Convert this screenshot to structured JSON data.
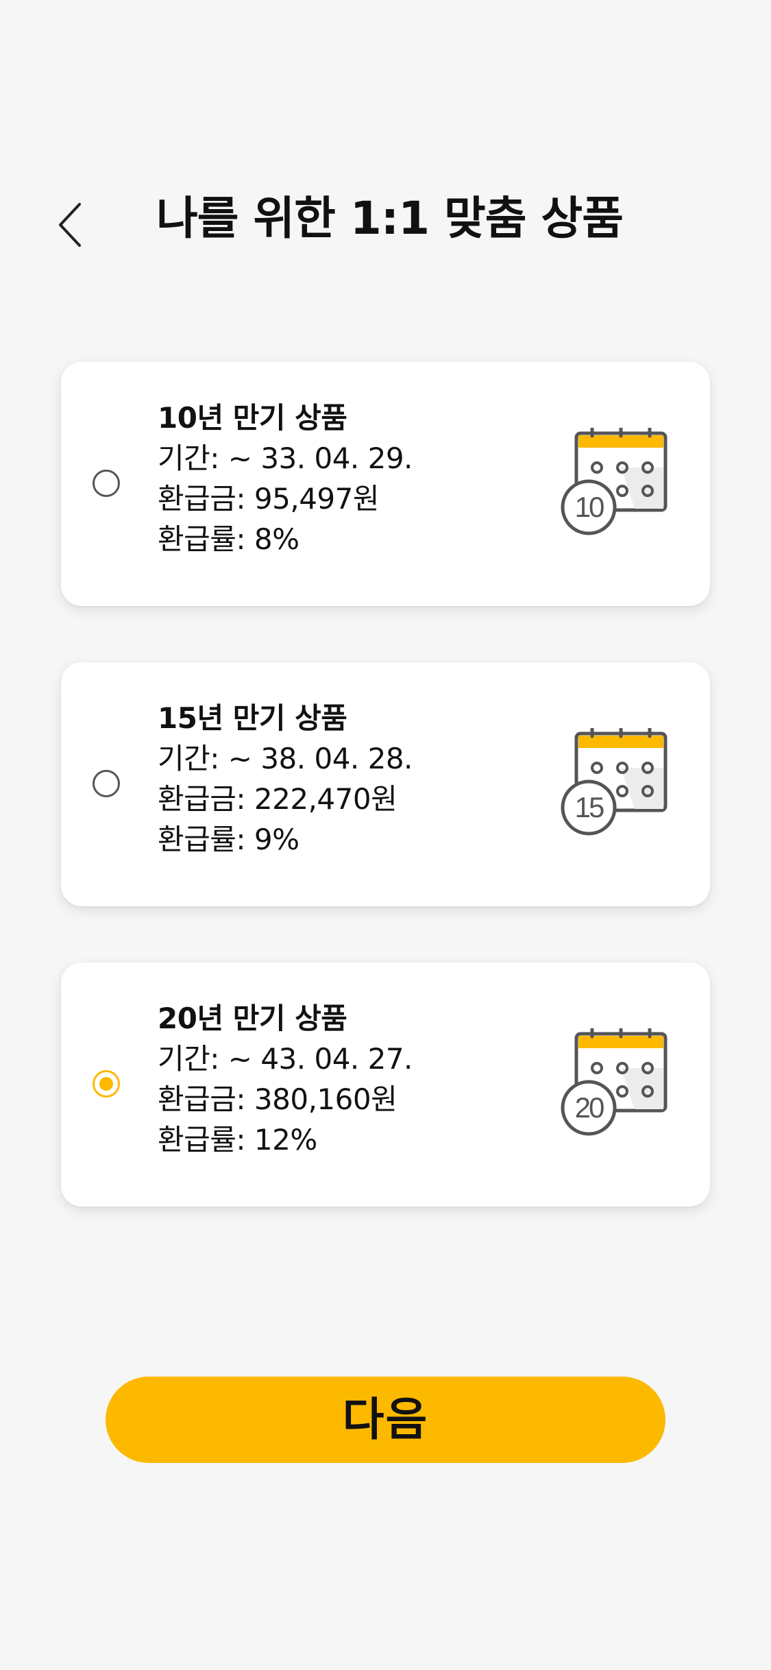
{
  "header": {
    "title": "나를 위한 1:1 맞춤 상품",
    "back_icon": "chevron-left-icon"
  },
  "products": [
    {
      "title": "10년 만기 상품",
      "period": "기간: ~ 33. 04. 29.",
      "refund_amount": "환급금: 95,497원",
      "refund_rate": "환급률: 8%",
      "icon": "calendar-icon",
      "badge": "10",
      "selected": false
    },
    {
      "title": "15년 만기 상품",
      "period": "기간: ~ 38. 04. 28.",
      "refund_amount": "환급금: 222,470원",
      "refund_rate": "환급률: 9%",
      "icon": "calendar-icon",
      "badge": "15",
      "selected": false
    },
    {
      "title": "20년 만기 상품",
      "period": "기간: ~ 43. 04. 27.",
      "refund_amount": "환급금: 380,160원",
      "refund_rate": "환급률: 12%",
      "icon": "calendar-icon",
      "badge": "20",
      "selected": true
    }
  ],
  "next_button": {
    "label": "다음"
  },
  "colors": {
    "accent": "#fcb900",
    "background": "#f6f6f6",
    "card": "#ffffff",
    "icon_gray": "#555555",
    "text": "#111111"
  }
}
